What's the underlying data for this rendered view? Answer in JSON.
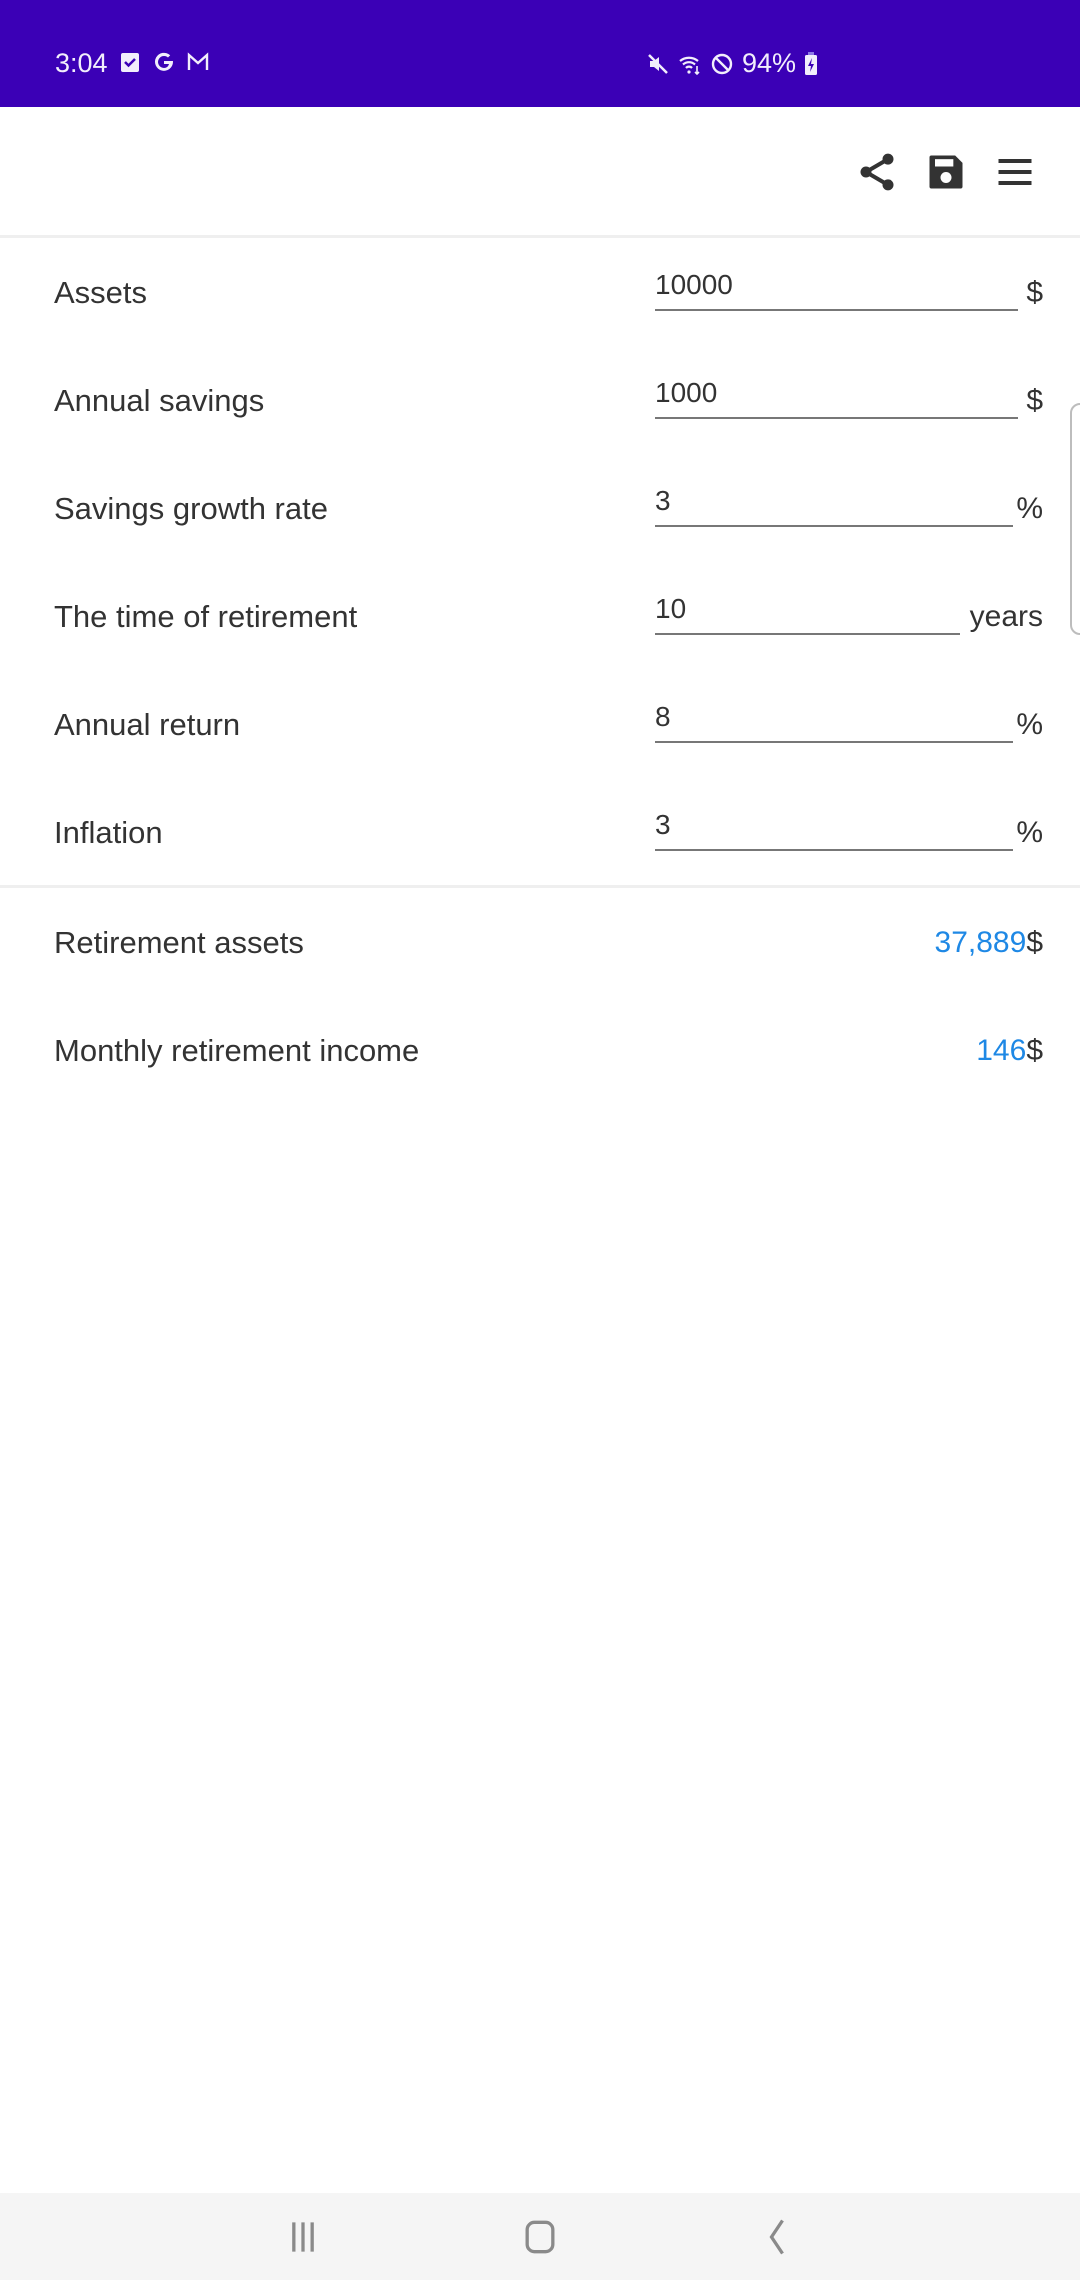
{
  "status_bar": {
    "time": "3:04",
    "left_icons": [
      "task-check-icon",
      "google-icon",
      "gmail-icon"
    ],
    "right_icons": [
      "mute-icon",
      "wifi-icon",
      "do-not-disturb-icon"
    ],
    "battery": "94%"
  },
  "app_bar": {
    "actions": [
      {
        "name": "share",
        "icon": "share-icon"
      },
      {
        "name": "save",
        "icon": "save-icon"
      },
      {
        "name": "menu",
        "icon": "menu-icon"
      }
    ]
  },
  "inputs": [
    {
      "label": "Assets",
      "value": "10000",
      "unit": "$"
    },
    {
      "label": "Annual savings",
      "value": "1000",
      "unit": "$"
    },
    {
      "label": "Savings growth rate",
      "value": "3",
      "unit": "%"
    },
    {
      "label": "The time of retirement",
      "value": "10",
      "unit": "years"
    },
    {
      "label": "Annual return",
      "value": "8",
      "unit": "%"
    },
    {
      "label": "Inflation",
      "value": "3",
      "unit": "%"
    }
  ],
  "results": [
    {
      "label": "Retirement assets",
      "value": "37,889",
      "unit": "$"
    },
    {
      "label": "Monthly retirement income",
      "value": "146",
      "unit": "$"
    }
  ],
  "colors": {
    "status_bar": "#3b00b6",
    "result_value": "#1e88e5",
    "text": "#333333"
  },
  "nav_bar": {
    "buttons": [
      "recent-apps",
      "home",
      "back"
    ]
  }
}
